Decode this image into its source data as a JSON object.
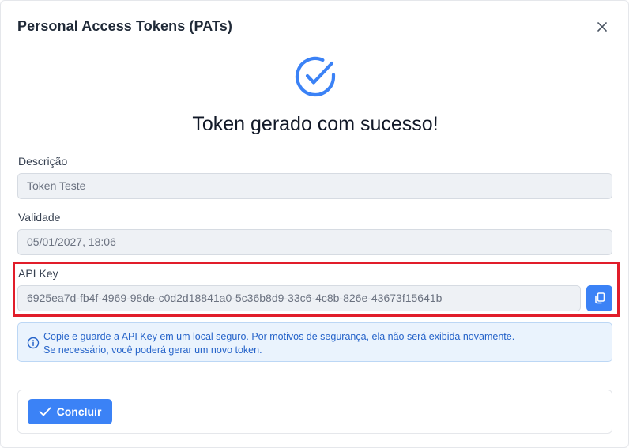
{
  "modal": {
    "title": "Personal Access Tokens (PATs)",
    "close_icon": "close-icon"
  },
  "success": {
    "icon": "check-circle-icon",
    "title": "Token gerado com sucesso!"
  },
  "fields": {
    "description": {
      "label": "Descrição",
      "value": "Token Teste"
    },
    "validity": {
      "label": "Validade",
      "value": "05/01/2027, 18:06"
    },
    "api_key": {
      "label": "API Key",
      "value": "6925ea7d-fb4f-4969-98de-c0d2d18841a0-5c36b8d9-33c6-4c8b-826e-43673f15641b",
      "copy_icon": "copy-icon"
    }
  },
  "info": {
    "icon": "info-icon",
    "line1": "Copie e guarde a API Key em um local seguro. Por motivos de segurança, ela não será exibida novamente.",
    "line2": "Se necessário, você poderá gerar um novo token."
  },
  "footer": {
    "confirm_label": "Concluir",
    "confirm_icon": "check-icon"
  },
  "colors": {
    "accent": "#3b82f6",
    "highlight": "#e11d2a",
    "info_bg": "#eaf3fd",
    "info_text": "#2563c9"
  }
}
